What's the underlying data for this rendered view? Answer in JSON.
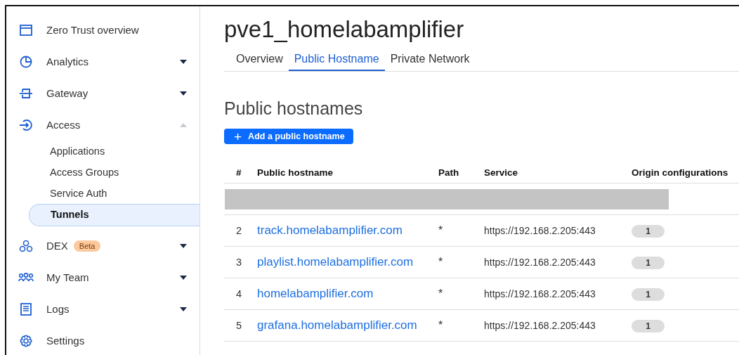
{
  "sidebar": {
    "items": [
      {
        "kind": "link",
        "label": "Zero Trust overview"
      },
      {
        "kind": "group",
        "label": "Analytics",
        "expanded": false
      },
      {
        "kind": "group",
        "label": "Gateway",
        "expanded": false
      },
      {
        "kind": "group",
        "label": "Access",
        "expanded": true,
        "children": [
          {
            "label": "Applications",
            "selected": false
          },
          {
            "label": "Access Groups",
            "selected": false
          },
          {
            "label": "Service Auth",
            "selected": false
          },
          {
            "label": "Tunnels",
            "selected": true
          }
        ]
      },
      {
        "kind": "group",
        "label": "DEX",
        "badge": "Beta",
        "expanded": false
      },
      {
        "kind": "group",
        "label": "My Team",
        "expanded": false
      },
      {
        "kind": "group",
        "label": "Logs",
        "expanded": false
      },
      {
        "kind": "link",
        "label": "Settings"
      }
    ]
  },
  "page": {
    "title": "pve1_homelabamplifier",
    "tabs": [
      {
        "label": "Overview",
        "selected": false
      },
      {
        "label": "Public Hostname",
        "selected": true
      },
      {
        "label": "Private Network",
        "selected": false
      }
    ],
    "section_title": "Public hostnames",
    "add_button": {
      "icon": "+",
      "label": "Add a public hostname"
    },
    "table": {
      "columns": [
        "#",
        "Public hostname",
        "Path",
        "Service",
        "Origin configurations"
      ],
      "rows": [
        {
          "kind": "redacted"
        },
        {
          "kind": "row",
          "index": "2",
          "hostname": "track.homelabamplifier.com",
          "path": "*",
          "service": "https://192.168.2.205:443",
          "origins": "1"
        },
        {
          "kind": "row",
          "index": "3",
          "hostname": "playlist.homelabamplifier.com",
          "path": "*",
          "service": "https://192.168.2.205:443",
          "origins": "1"
        },
        {
          "kind": "row",
          "index": "4",
          "hostname": "homelabamplifier.com",
          "path": "*",
          "service": "https://192.168.2.205:443",
          "origins": "1"
        },
        {
          "kind": "row",
          "index": "5",
          "hostname": "grafana.homelabamplifier.com",
          "path": "*",
          "service": "https://192.168.2.205:443",
          "origins": "1"
        }
      ]
    }
  }
}
